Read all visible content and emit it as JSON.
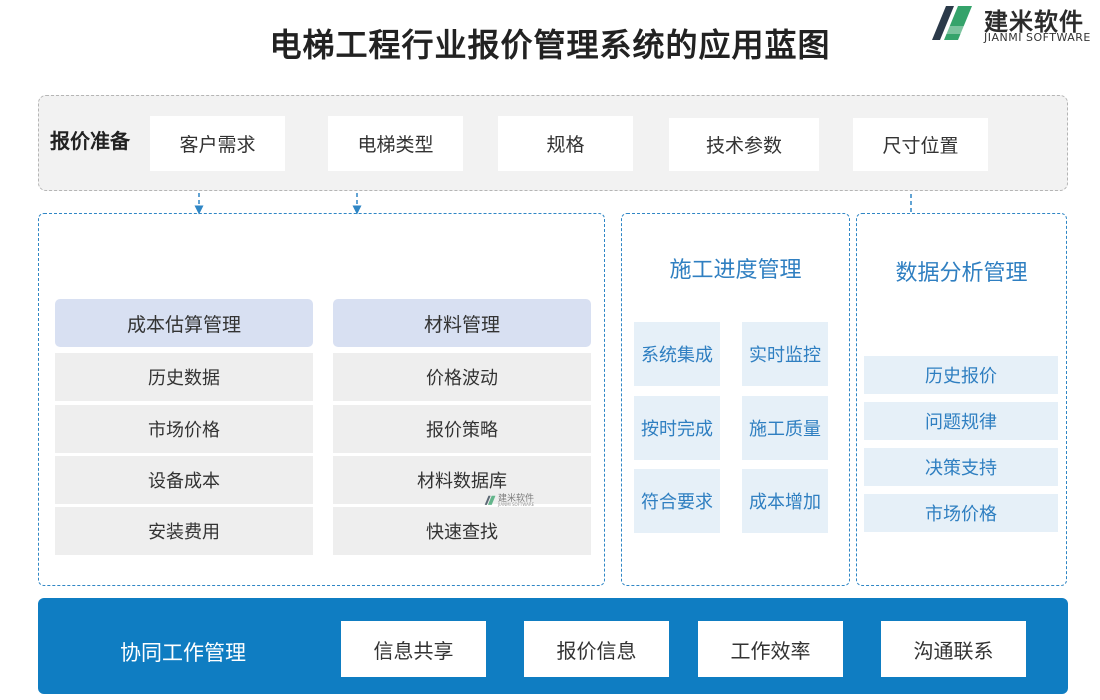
{
  "title": "电梯工程行业报价管理系统的应用蓝图",
  "logo": {
    "cn": "建米软件",
    "en": "JIANMI SOFTWARE"
  },
  "prep": {
    "label": "报价准备",
    "items": [
      "客户需求",
      "电梯类型",
      "规格",
      "技术参数",
      "尺寸位置"
    ]
  },
  "cost": {
    "title": "成本估算管理",
    "items": [
      "历史数据",
      "市场价格",
      "设备成本",
      "安装费用"
    ]
  },
  "material": {
    "title": "材料管理",
    "items": [
      "价格波动",
      "报价策略",
      "材料数据库",
      "快速查找"
    ]
  },
  "construction": {
    "title": "施工进度管理",
    "items": [
      "系统集成",
      "实时监控",
      "按时完成",
      "施工质量",
      "符合要求",
      "成本增加"
    ]
  },
  "analysis": {
    "title": "数据分析管理",
    "items": [
      "历史报价",
      "问题规律",
      "决策支持",
      "市场价格"
    ]
  },
  "collab": {
    "label": "协同工作管理",
    "items": [
      "信息共享",
      "报价信息",
      "工作效率",
      "沟通联系"
    ]
  },
  "colors": {
    "accent": "#0f7dc2",
    "header_fill": "#d8e0f2",
    "dashed": "#2f86c5"
  }
}
